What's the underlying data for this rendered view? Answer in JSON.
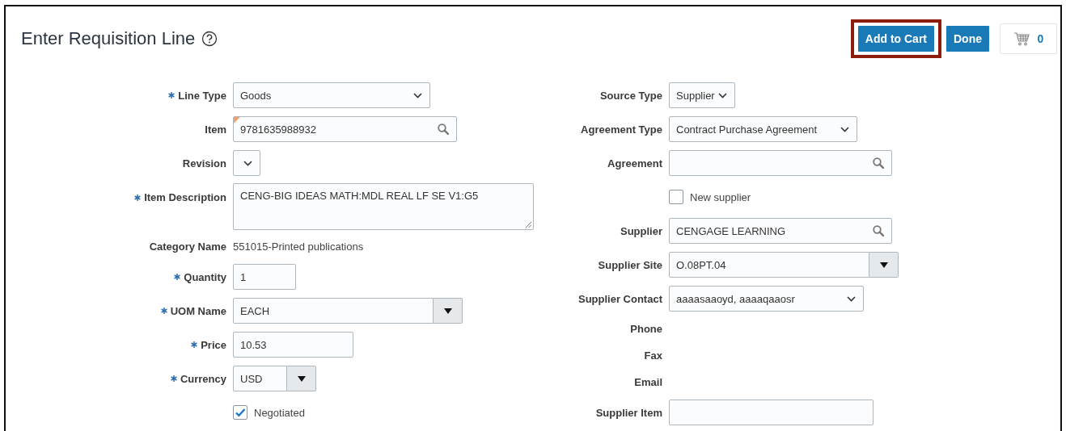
{
  "header": {
    "title": "Enter Requisition Line",
    "buttons": [
      {
        "label": "Add to Cart",
        "highlighted": true
      },
      {
        "label": "Done",
        "highlighted": false
      }
    ],
    "cart": {
      "count": "0"
    }
  },
  "left": [
    {
      "kind": "select",
      "label": "Line Type",
      "required": true,
      "value": "Goods",
      "modified": false
    },
    {
      "kind": "lov",
      "label": "Item",
      "required": false,
      "value": "9781635988932",
      "modified": true
    },
    {
      "kind": "select",
      "label": "Revision",
      "required": false,
      "modified": false
    },
    {
      "kind": "textarea",
      "label": "Item Description",
      "required": true,
      "value": "CENG-BIG IDEAS MATH:MDL REAL LF SE V1:G5",
      "modified": false
    },
    {
      "kind": "readonly",
      "label": "Category Name",
      "required": false,
      "value": "551015-Printed publications",
      "modified": false
    },
    {
      "kind": "text",
      "label": "Quantity",
      "required": true,
      "value": "1",
      "modified": false
    },
    {
      "kind": "choice",
      "label": "UOM Name",
      "required": true,
      "value": "EACH",
      "modified": false
    },
    {
      "kind": "text",
      "label": "Price",
      "required": true,
      "value": "10.53",
      "modified": false
    },
    {
      "kind": "choice",
      "label": "Currency",
      "required": true,
      "value": "USD",
      "modified": false
    },
    {
      "kind": "checkbox",
      "text": "Negotiated",
      "checked": true
    }
  ],
  "right": [
    {
      "kind": "select",
      "label": "Source Type",
      "required": false,
      "value": "Supplier",
      "modified": false
    },
    {
      "kind": "select",
      "label": "Agreement Type",
      "required": false,
      "value": "Contract Purchase Agreement",
      "modified": false
    },
    {
      "kind": "lov",
      "label": "Agreement",
      "required": false,
      "modified": false
    },
    {
      "kind": "checkbox",
      "text": "New supplier",
      "checked": false
    },
    {
      "kind": "lov",
      "label": "Supplier",
      "required": false,
      "value": "CENGAGE LEARNING",
      "modified": false
    },
    {
      "kind": "choice",
      "label": "Supplier Site",
      "required": false,
      "value": "O.08PT.04",
      "modified": false
    },
    {
      "kind": "select",
      "label": "Supplier Contact",
      "required": false,
      "value": "aaaasaaoyd, aaaaqaaosr",
      "modified": false
    },
    {
      "kind": "readonly",
      "label": "Phone",
      "required": false,
      "modified": false
    },
    {
      "kind": "readonly",
      "label": "Fax",
      "required": false,
      "modified": false
    },
    {
      "kind": "readonly",
      "label": "Email",
      "required": false,
      "modified": false
    },
    {
      "kind": "text",
      "label": "Supplier Item",
      "required": false,
      "modified": false
    }
  ]
}
